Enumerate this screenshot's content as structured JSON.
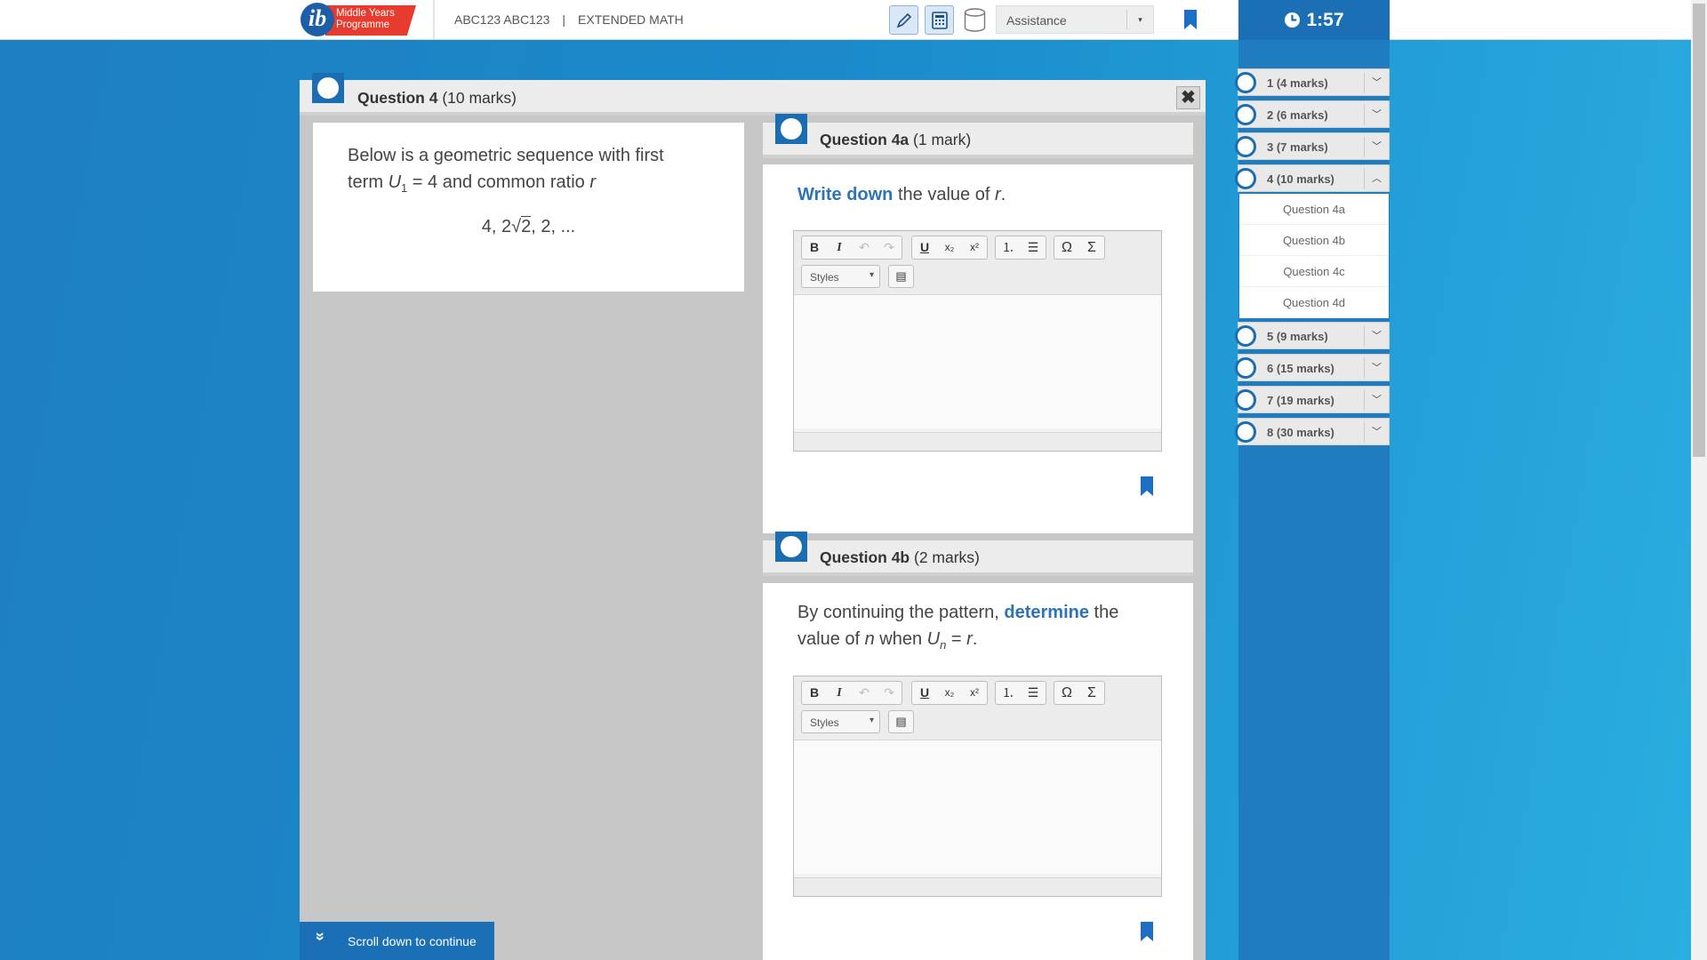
{
  "header": {
    "logo": {
      "letter": "ib",
      "tag_line1": "Middle Years",
      "tag_line2": "Programme"
    },
    "candidate": "ABC123 ABC123",
    "separator": "|",
    "subject": "EXTENDED MATH",
    "tools": [
      "pen-icon",
      "calculator-icon",
      "cylinder-icon"
    ],
    "assistance": {
      "label": "Assistance",
      "dropdown_icon": "▾"
    },
    "timer": "1:57"
  },
  "nav": {
    "items": [
      {
        "label": "1 (4 marks)",
        "chevron": "﹀"
      },
      {
        "label": "2 (6 marks)",
        "chevron": "﹀"
      },
      {
        "label": "3 (7 marks)",
        "chevron": "﹀"
      },
      {
        "label": "4 (10 marks)",
        "chevron": "︿"
      },
      {
        "label": "5 (9 marks)",
        "chevron": "﹀"
      },
      {
        "label": "6 (15 marks)",
        "chevron": "﹀"
      },
      {
        "label": "7 (19 marks)",
        "chevron": "﹀"
      },
      {
        "label": "8 (30 marks)",
        "chevron": "﹀"
      }
    ],
    "subitems": [
      "Question 4a",
      "Question 4b",
      "Question 4c",
      "Question 4d"
    ]
  },
  "question": {
    "title": "Question 4",
    "marks": "(10 marks)",
    "close": "✖",
    "stem_line1": "Below is a geometric sequence with first",
    "stem_term_prefix": "term ",
    "stem_u": "U",
    "stem_sub": "1",
    "stem_rest": " = 4 and common ratio ",
    "stem_r": "r",
    "seq_a": "4, 2",
    "seq_root": "√",
    "seq_rad": "2",
    "seq_b": ", 2, ..."
  },
  "parts": [
    {
      "title": "Question 4a",
      "marks": "(1 mark)",
      "keyword": "Write down",
      "text_a": " the value of ",
      "var": "r",
      "text_b": "."
    },
    {
      "title": "Question 4b",
      "marks": "(2 marks)",
      "text_a": "By continuing the pattern, ",
      "keyword": "determine",
      "text_b": " the",
      "line2_a": "value of ",
      "var_n": "n",
      "line2_b": " when ",
      "var_u": "U",
      "sub_n": "n",
      "line2_c": " = ",
      "var_r": "r",
      "line2_d": "."
    }
  ],
  "editor": {
    "bold": "B",
    "italic": "I",
    "undo": "↶",
    "redo": "↷",
    "underline": "U",
    "subscript": "x₂",
    "superscript": "x²",
    "ordered": "⒈",
    "bullet": "☰",
    "omega": "Ω",
    "sigma": "Σ",
    "styles": "Styles",
    "source": "▤"
  },
  "scroll_hint": {
    "label": "Scroll down to continue",
    "icon": "»"
  },
  "colors": {
    "accent": "#1b6db2",
    "keyword": "#2c73b8",
    "bookmark": "#1a6fc4",
    "logo_red": "#e63b2e"
  }
}
